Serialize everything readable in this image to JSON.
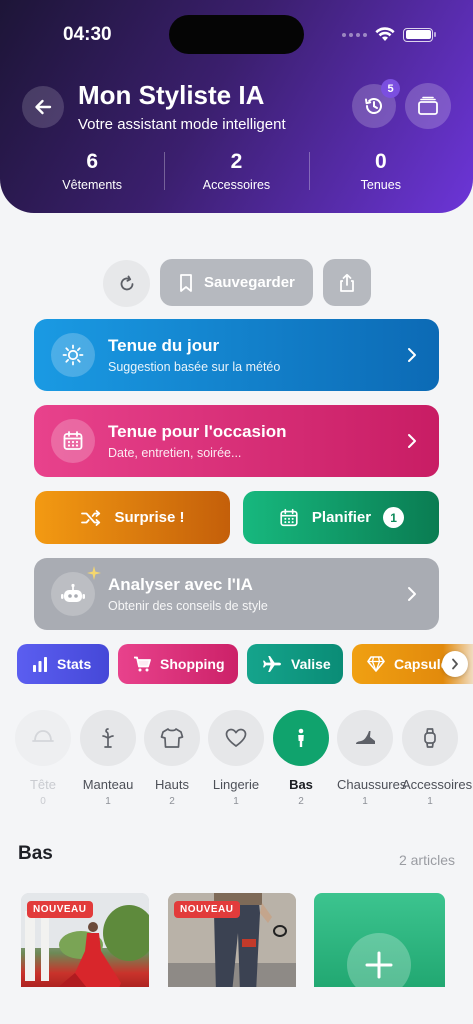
{
  "status": {
    "time": "04:30"
  },
  "header": {
    "title": "Mon Styliste IA",
    "subtitle": "Votre assistant mode intelligent",
    "history_badge": "5",
    "stats": [
      {
        "value": "6",
        "label": "Vêtements"
      },
      {
        "value": "2",
        "label": "Accessoires"
      },
      {
        "value": "0",
        "label": "Tenues"
      }
    ]
  },
  "actions": {
    "save_label": "Sauvegarder"
  },
  "cards": {
    "weather": {
      "title": "Tenue du jour",
      "subtitle": "Suggestion basée sur la météo"
    },
    "occasion": {
      "title": "Tenue pour l'occasion",
      "subtitle": "Date, entretien, soirée..."
    },
    "surprise": {
      "label": "Surprise !"
    },
    "plan": {
      "label": "Planifier",
      "count": "1"
    },
    "ai": {
      "title": "Analyser avec l'IA",
      "subtitle": "Obtenir des conseils de style"
    }
  },
  "chips": [
    {
      "label": "Stats",
      "icon": "bar-chart-icon"
    },
    {
      "label": "Shopping",
      "icon": "cart-icon"
    },
    {
      "label": "Valise",
      "icon": "plane-icon"
    },
    {
      "label": "Capsule",
      "icon": "diamond-icon"
    }
  ],
  "categories": [
    {
      "label": "Tête",
      "count": "0",
      "icon": "hat-icon"
    },
    {
      "label": "Manteau",
      "count": "1",
      "icon": "hanger-icon"
    },
    {
      "label": "Hauts",
      "count": "2",
      "icon": "shirt-icon"
    },
    {
      "label": "Lingerie",
      "count": "1",
      "icon": "heart-icon"
    },
    {
      "label": "Bas",
      "count": "2",
      "icon": "person-icon"
    },
    {
      "label": "Chaussures",
      "count": "1",
      "icon": "shoe-icon"
    },
    {
      "label": "Accessoires",
      "count": "1",
      "icon": "watch-icon"
    }
  ],
  "section": {
    "title": "Bas",
    "count": "2 articles",
    "items": [
      {
        "tag": "NOUVEAU"
      },
      {
        "tag": "NOUVEAU"
      }
    ]
  }
}
